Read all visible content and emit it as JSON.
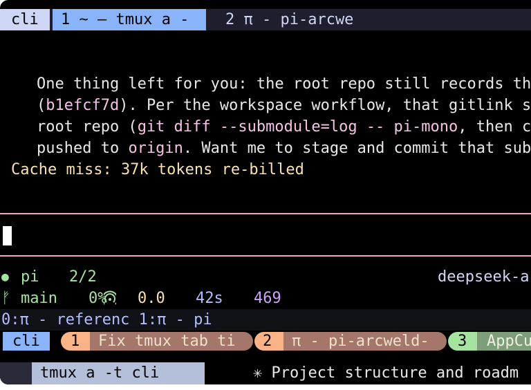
{
  "top_bar": {
    "session": "cli",
    "active_window": "1 ~ — tmux a -",
    "other_window": "2 π - pi-arcwe"
  },
  "message": {
    "line1": "One thing left for you: the root repo still records the",
    "line2_open": "(",
    "line2_hash": "b1efcf7d",
    "line2_rest": "). Per the workspace workflow, that gitlink sh",
    "line3_pre": "root repo (",
    "line3_cmd": "git diff --submodule=log -- pi-mono",
    "line3_post": ", then co",
    "line4_pre": "pushed to ",
    "line4_remote": "origin",
    "line4_post": ". Want me to stage and commit that subm"
  },
  "cache_notice": "Cache miss: 37k tokens re-billed",
  "status": {
    "dot": "●",
    "app": "pi",
    "agents": "2/2",
    "model": "deepseek-a",
    "branch_icon": "ᚠ",
    "branch": "main",
    "context_pct": "0%",
    "cost": "0.0",
    "elapsed": "42s",
    "tokens": "469"
  },
  "tmux_line": "0:π - referenc 1:π - pi",
  "tabs": {
    "session": "cli",
    "tab1_num": "1",
    "tab1_label": "Fix tmux tab ti",
    "tab2_num": "2",
    "tab2_label": "π - pi-arcweld-",
    "tab3_num": "3",
    "tab3_label": "AppCu"
  },
  "bottom": {
    "title": "tmux a -t cli",
    "project": "✳ Project structure and roadm"
  },
  "colors": {
    "accent_blue": "#89b4fa",
    "peach": "#fab387",
    "brown": "#a4776a",
    "green": "#a6e3a1",
    "pink_rule": "#f0a9b4"
  }
}
